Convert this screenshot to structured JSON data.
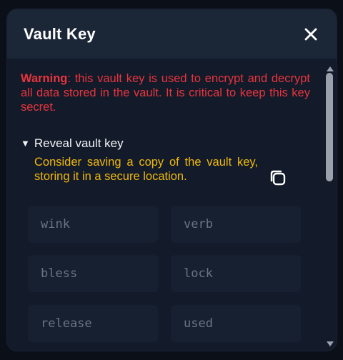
{
  "modal": {
    "title": "Vault Key"
  },
  "warning": {
    "label": "Warning",
    "text": ": this vault key is used to encrypt and decrypt all data stored in the vault. It is critical to keep this key secret."
  },
  "reveal": {
    "toggle_symbol": "▼",
    "label": "Reveal vault key"
  },
  "note": {
    "text": "Consider saving a copy of the vault key, storing it in a secure location."
  },
  "words": [
    "wink",
    "verb",
    "bless",
    "lock",
    "release",
    "used"
  ],
  "icons": {
    "close": "close-icon",
    "copy": "copy-icon"
  },
  "colors": {
    "warning": "#e8353d",
    "note": "#f0b90b",
    "header": "#1b2637",
    "panel": "#131a2a"
  }
}
